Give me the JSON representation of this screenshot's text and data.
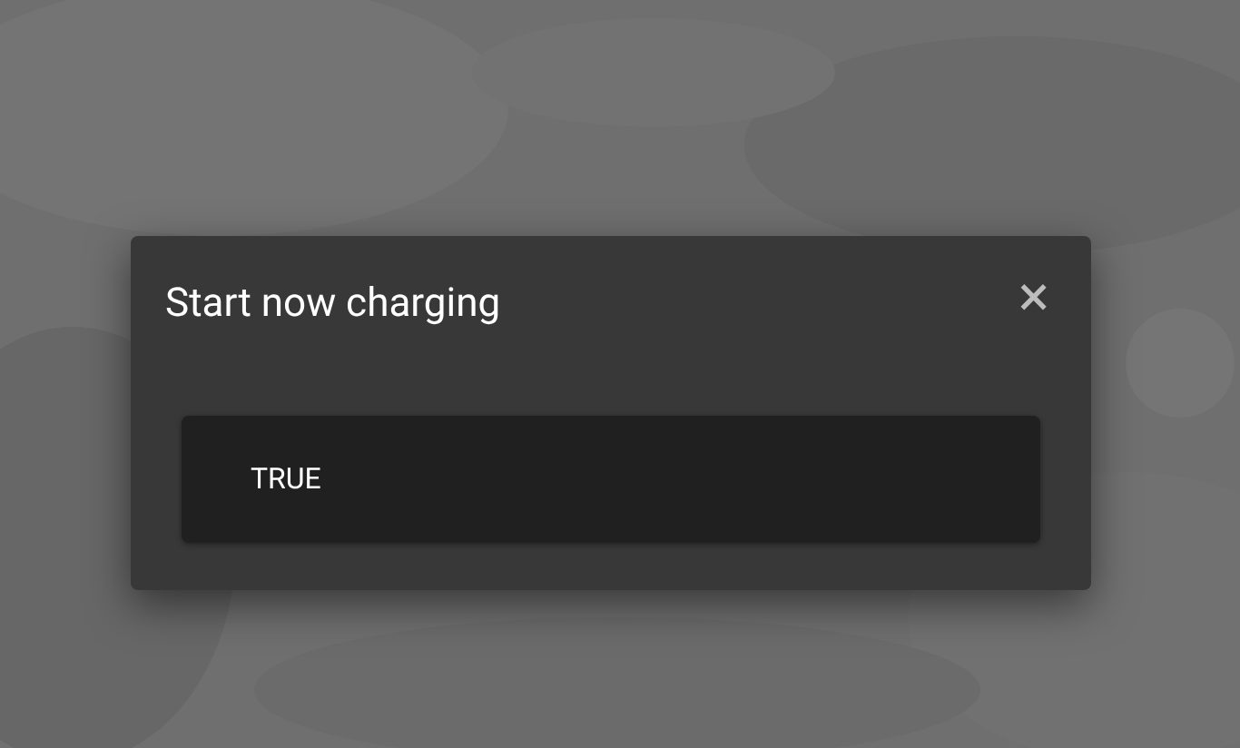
{
  "dialog": {
    "title": "Start now charging",
    "close": "×",
    "option": {
      "label": "TRUE"
    }
  }
}
